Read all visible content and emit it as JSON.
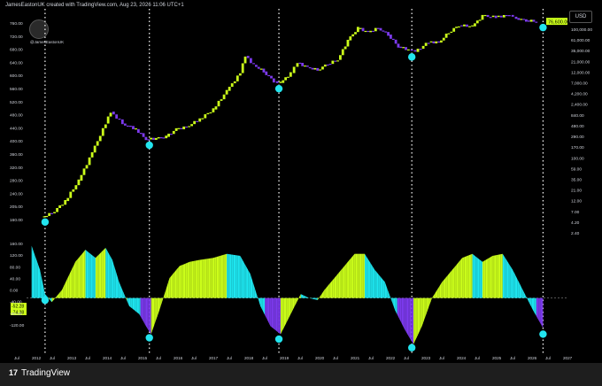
{
  "header": {
    "title": "JamesEastonUK created with TradingView.com, Aug 23, 2026 11:06 UTC+1",
    "currency": "USD",
    "watermark": "@JamesEastonUK"
  },
  "footer": {
    "brand": "TradingView",
    "logo": "17"
  },
  "colors": {
    "background": "#000000",
    "lime": "#ccff1a",
    "cyan": "#1ee6f0",
    "purple": "#7c3aed",
    "marker": "#22e5ef",
    "axis_text": "#d1d4dc",
    "grid_dots": "#ffffff"
  },
  "x_axis_labels": [
    "Jul",
    "2012",
    "Jul",
    "2013",
    "Jul",
    "2014",
    "Jul",
    "2015",
    "Jul",
    "2016",
    "Jul",
    "2017",
    "Jul",
    "2018",
    "Jul",
    "2019",
    "Jul",
    "2020",
    "Jul",
    "2021",
    "Jul",
    "2022",
    "Jul",
    "2023",
    "Jul",
    "2024",
    "Jul",
    "2025",
    "Jul",
    "2026",
    "Jul",
    "2027"
  ],
  "chart_data": [
    {
      "type": "line",
      "pane": "price",
      "scale": "log",
      "left_tick_labels": [
        "760.00",
        "720.00",
        "680.00",
        "640.00",
        "600.00",
        "560.00",
        "520.00",
        "480.00",
        "440.00",
        "400.00",
        "360.00",
        "320.00",
        "280.00",
        "240.00",
        "205.00",
        "160.00"
      ],
      "right_tick_labels": [
        "100,000.00",
        "61,000.00",
        "35,000.00",
        "21,000.00",
        "12,000.00",
        "7,000.00",
        "4,200.00",
        "2,400.00",
        "840.00",
        "480.00",
        "290.00",
        "170.00",
        "100.00",
        "59.00",
        "35.00",
        "21.00",
        "12.00",
        "7.00",
        "4.20",
        "2.40"
      ],
      "price_label": "76,600.00",
      "x": [
        2011.9,
        2012.2,
        2012.6,
        2013.0,
        2013.4,
        2013.8,
        2013.95,
        2014.3,
        2014.7,
        2015.0,
        2015.3,
        2015.6,
        2015.9,
        2016.2,
        2016.6,
        2017.0,
        2017.4,
        2017.8,
        2017.95,
        2018.2,
        2018.5,
        2018.8,
        2019.0,
        2019.3,
        2019.5,
        2019.8,
        2020.1,
        2020.4,
        2020.7,
        2021.0,
        2021.3,
        2021.6,
        2021.9,
        2022.2,
        2022.5,
        2022.8,
        2023.0,
        2023.4,
        2023.7,
        2024.0,
        2024.3,
        2024.7,
        2025.0,
        2025.4,
        2025.8,
        2026.0,
        2026.3,
        2026.6
      ],
      "y": [
        5,
        6,
        11,
        30,
        120,
        500,
        900,
        500,
        380,
        230,
        240,
        260,
        380,
        420,
        630,
        1000,
        2500,
        6000,
        14000,
        9000,
        6500,
        4000,
        3700,
        6000,
        10000,
        8000,
        7000,
        9500,
        11500,
        30000,
        55000,
        45000,
        55000,
        40000,
        22000,
        19000,
        17000,
        28000,
        27000,
        45000,
        63000,
        60000,
        100000,
        95000,
        105000,
        90000,
        80000,
        76600
      ],
      "marker_x": [
        2012.0,
        2015.1,
        2018.95,
        2022.9,
        2026.8
      ]
    },
    {
      "type": "area",
      "pane": "oscillator",
      "tick_labels": [
        "160.00",
        "120.00",
        "80.00",
        "40.00",
        "0.00",
        "-40.00",
        "-80.00",
        "-120.00"
      ],
      "last_value_labels": [
        "-52.28",
        "-74.38"
      ],
      "x": [
        2011.6,
        2011.85,
        2012.0,
        2012.2,
        2012.5,
        2012.9,
        2013.2,
        2013.5,
        2013.8,
        2014.0,
        2014.2,
        2014.5,
        2014.8,
        2015.0,
        2015.15,
        2015.4,
        2015.7,
        2016.0,
        2016.3,
        2016.6,
        2017.0,
        2017.4,
        2017.8,
        2018.1,
        2018.4,
        2018.7,
        2019.0,
        2019.3,
        2019.6,
        2019.85,
        2020.1,
        2020.3,
        2020.6,
        2020.9,
        2021.2,
        2021.5,
        2021.8,
        2022.1,
        2022.4,
        2022.7,
        2022.95,
        2023.2,
        2023.5,
        2023.8,
        2024.1,
        2024.4,
        2024.7,
        2025.0,
        2025.3,
        2025.6,
        2025.9,
        2026.2,
        2026.5,
        2026.8
      ],
      "y": [
        130,
        70,
        10,
        -10,
        20,
        90,
        120,
        100,
        125,
        95,
        40,
        -20,
        -40,
        -70,
        -90,
        -30,
        50,
        80,
        90,
        95,
        100,
        110,
        105,
        60,
        -20,
        -70,
        -90,
        -40,
        10,
        0,
        -5,
        20,
        50,
        80,
        110,
        110,
        70,
        40,
        -30,
        -80,
        -115,
        -70,
        0,
        40,
        70,
        100,
        110,
        90,
        105,
        110,
        70,
        20,
        -30,
        -74.38
      ]
    }
  ]
}
